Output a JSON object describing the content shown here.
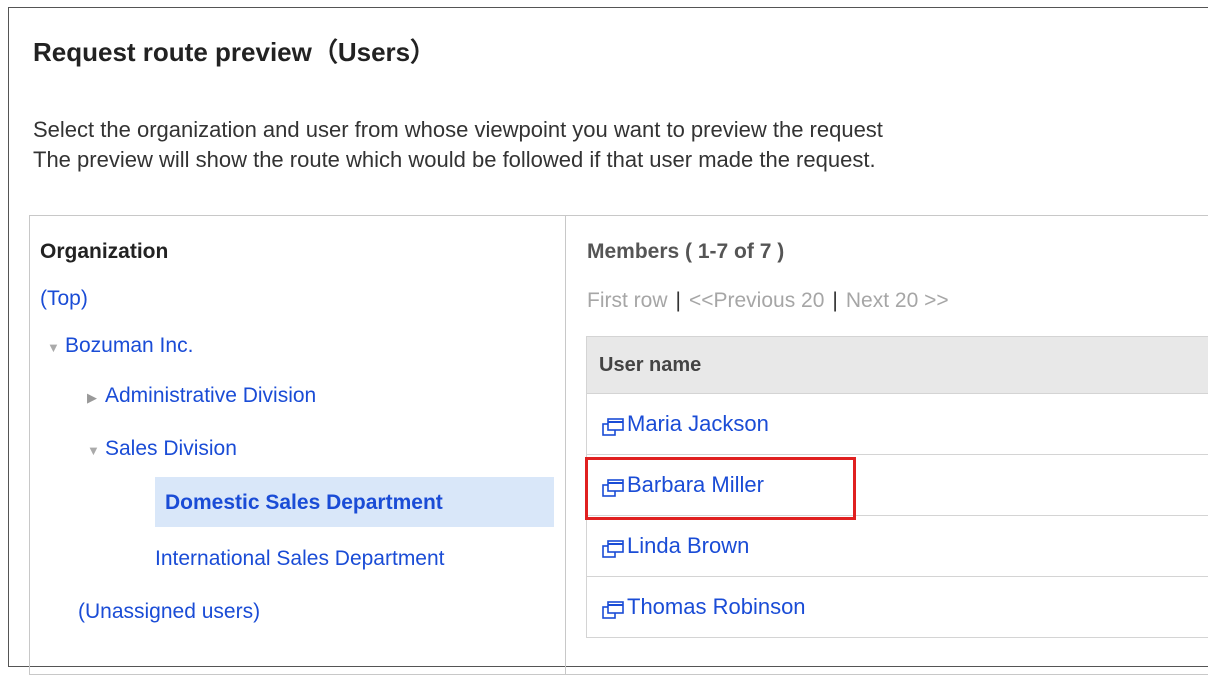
{
  "page": {
    "title": "Request route preview（Users）",
    "description_line1": "Select the organization and user from whose viewpoint you want to preview the request",
    "description_line2": "The preview will show the route which would be followed if that user made the request."
  },
  "organization": {
    "heading": "Organization",
    "top_link": "(Top)",
    "root": "Bozuman Inc.",
    "children": [
      {
        "label": "Administrative Division",
        "state": "collapsed"
      },
      {
        "label": "Sales Division",
        "state": "expanded"
      }
    ],
    "sales_children": [
      {
        "label": "Domestic Sales Department",
        "selected": true
      },
      {
        "label": "International Sales Department",
        "selected": false
      }
    ],
    "unassigned": "(Unassigned users)"
  },
  "members": {
    "heading": "Members ( 1-7 of 7 )",
    "pager": {
      "first": "First row",
      "previous": "<<Previous 20",
      "next": "Next 20 >>",
      "separator": "|"
    },
    "column_header": "User name",
    "rows": [
      "Maria Jackson",
      "Barbara Miller",
      "Linda Brown",
      "Thomas Robinson"
    ],
    "highlighted_row": "Barbara Miller"
  },
  "colors": {
    "link": "#1a4cd6",
    "selected_bg": "#d9e7f9",
    "highlight": "#e02020"
  }
}
